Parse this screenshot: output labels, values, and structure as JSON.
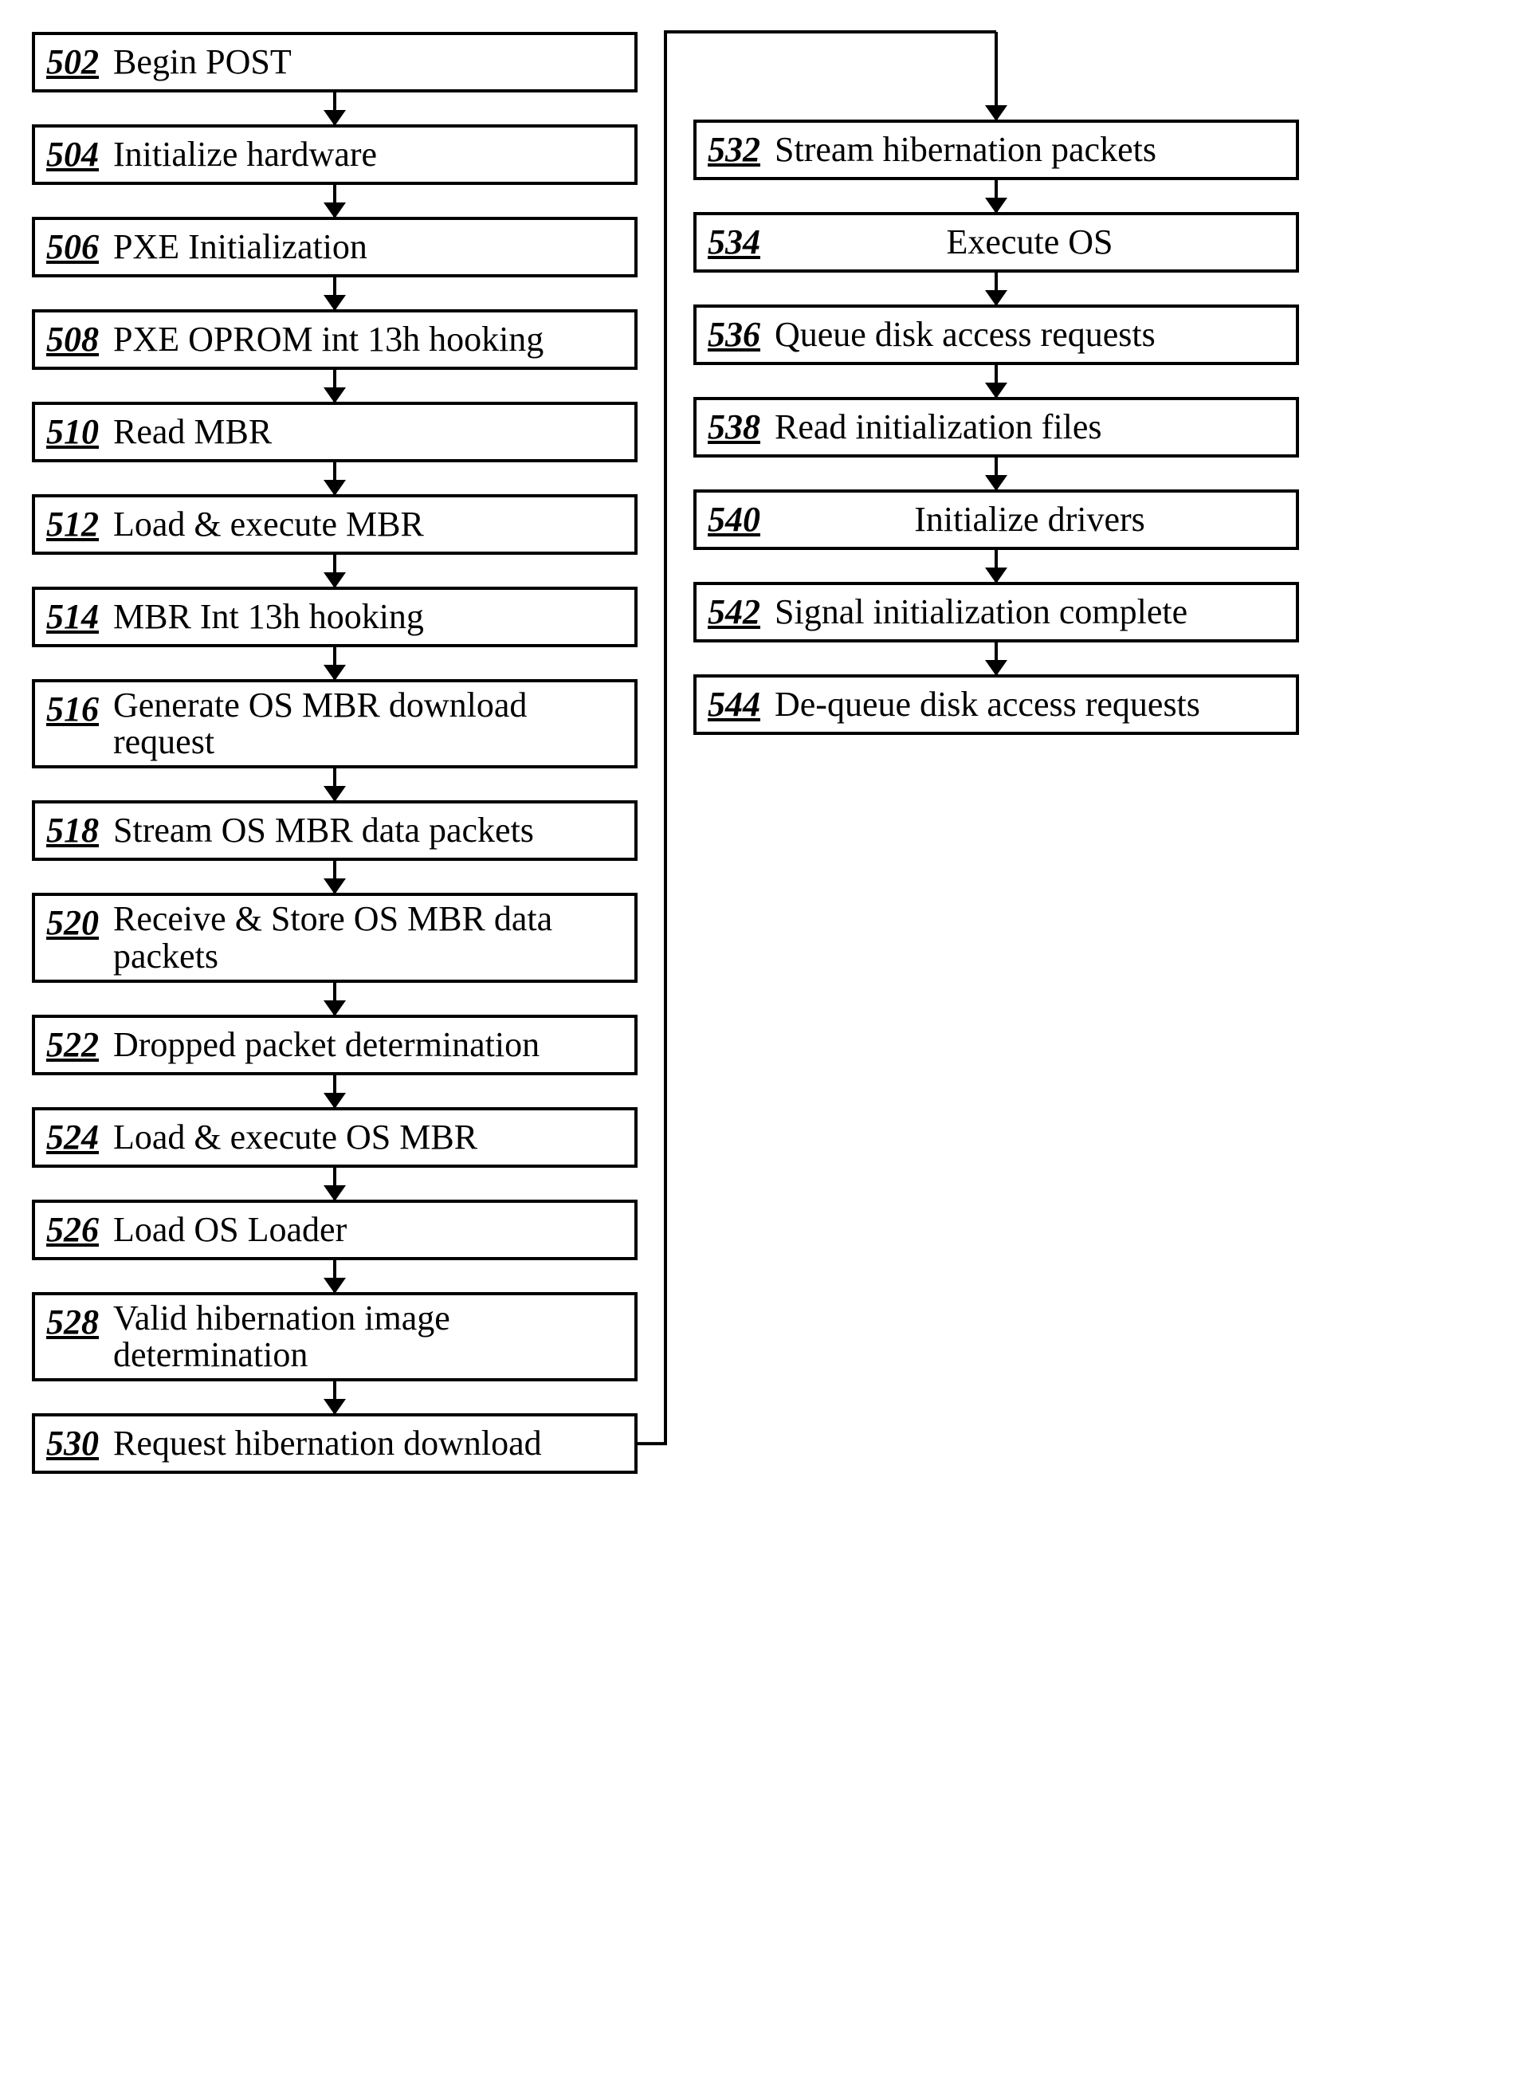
{
  "left_column": [
    {
      "num": "502",
      "label": "Begin POST"
    },
    {
      "num": "504",
      "label": "Initialize hardware"
    },
    {
      "num": "506",
      "label": "PXE Initialization"
    },
    {
      "num": "508",
      "label": "PXE OPROM int 13h hooking"
    },
    {
      "num": "510",
      "label": "Read MBR"
    },
    {
      "num": "512",
      "label": "Load & execute MBR"
    },
    {
      "num": "514",
      "label": "MBR Int 13h hooking"
    },
    {
      "num": "516",
      "label": "Generate OS MBR download request",
      "tall": true
    },
    {
      "num": "518",
      "label": "Stream OS MBR data packets"
    },
    {
      "num": "520",
      "label": "Receive & Store OS MBR data packets",
      "tall": true
    },
    {
      "num": "522",
      "label": "Dropped packet determination"
    },
    {
      "num": "524",
      "label": "Load & execute OS MBR"
    },
    {
      "num": "526",
      "label": "Load OS Loader"
    },
    {
      "num": "528",
      "label": "Valid hibernation image determination",
      "tall": true
    },
    {
      "num": "530",
      "label": "Request hibernation download"
    }
  ],
  "right_column": [
    {
      "num": "532",
      "label": "Stream hibernation packets"
    },
    {
      "num": "534",
      "label": "Execute OS",
      "center": true
    },
    {
      "num": "536",
      "label": "Queue disk access requests"
    },
    {
      "num": "538",
      "label": "Read initialization files"
    },
    {
      "num": "540",
      "label": "Initialize drivers",
      "center": true
    },
    {
      "num": "542",
      "label": "Signal initialization complete"
    },
    {
      "num": "544",
      "label": "De-queue disk access requests"
    }
  ]
}
